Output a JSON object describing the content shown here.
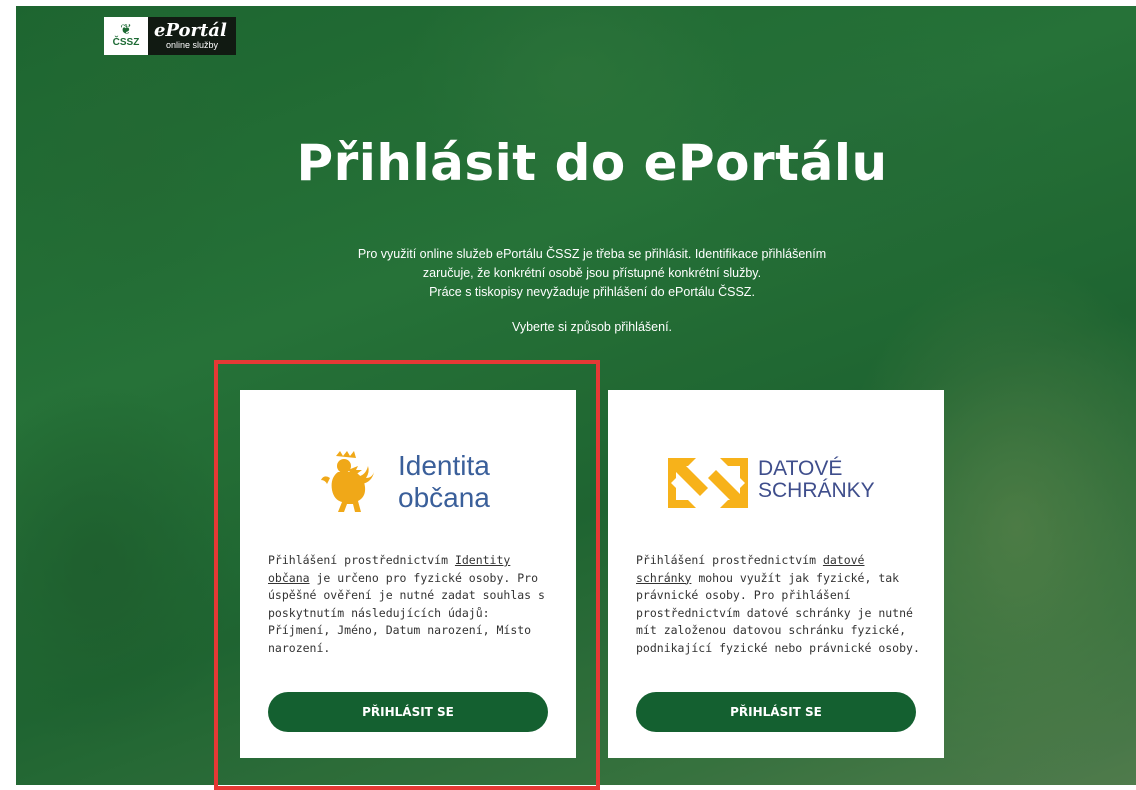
{
  "brand": {
    "abbr": "ČSSZ",
    "name": "ePortál",
    "subtitle": "online služby"
  },
  "page": {
    "title": "Přihlásit do ePortálu",
    "intro_lines": [
      "Pro využití online služeb ePortálu ČSSZ je třeba se přihlásit. Identifikace přihlášením",
      "zaručuje, že konkrétní osobě jsou přístupné konkrétní služby.",
      "Práce s tiskopisy nevyžaduje přihlášení do ePortálu ČSSZ."
    ],
    "choose": "Vyberte si způsob přihlášení."
  },
  "cards": [
    {
      "logo_line1": "Identita",
      "logo_line2": "občana",
      "text_before": "Přihlášení prostřednictvím ",
      "link": "Identity občana",
      "text_after": " je určeno pro fyzické osoby. Pro úspěšné ověření je nutné zadat souhlas s poskytnutím následujících údajů: Příjmení, Jméno, Datum narození, Místo narození.",
      "button": "PŘIHLÁSIT SE"
    },
    {
      "logo_line1": "DATOVÉ",
      "logo_line2": "SCHRÁNKY",
      "text_before": "Přihlášení prostřednictvím ",
      "link": "datové schránky",
      "text_after": " mohou využít jak fyzické, tak právnické osoby. Pro přihlášení prostřednictvím datové schránky je nutné mít založenou datovou schránku fyzické, podnikající fyzické nebo právnické osoby.",
      "button": "PŘIHLÁSIT SE"
    }
  ],
  "colors": {
    "accent_green": "#146030",
    "highlight_red": "#e53935",
    "lion_gold": "#f0a818",
    "ds_yellow": "#f7b21a"
  }
}
